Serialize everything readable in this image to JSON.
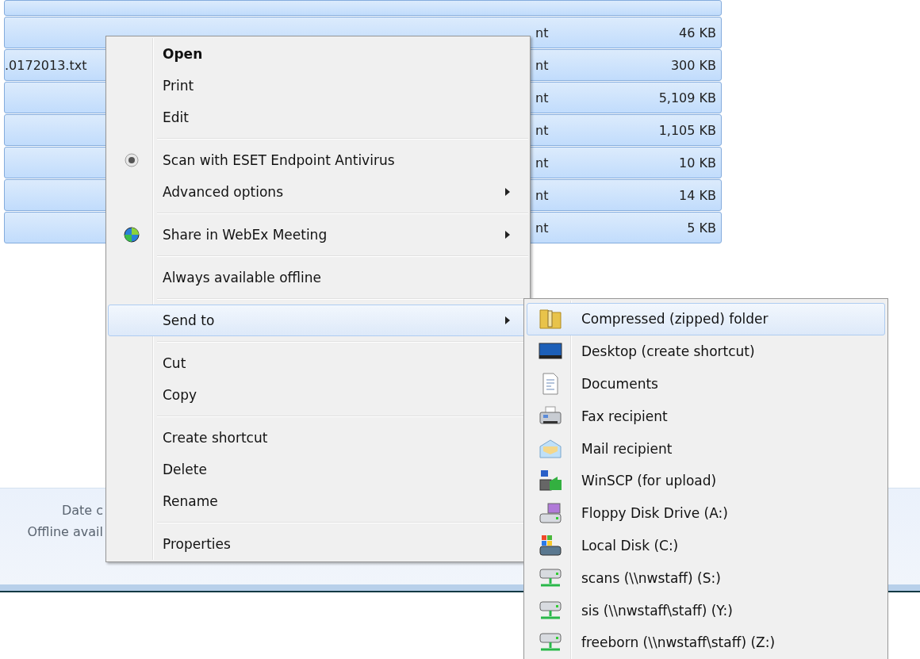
{
  "file_list": {
    "rows": [
      {
        "name": "",
        "type": "",
        "size": "",
        "selected": true
      },
      {
        "name": "",
        "type": "nt",
        "size": "46 KB",
        "selected": true
      },
      {
        "name": ".0172013.txt",
        "type": "nt",
        "size": "300 KB",
        "selected": true
      },
      {
        "name": "",
        "type": "nt",
        "size": "5,109 KB",
        "selected": true
      },
      {
        "name": "",
        "type": "nt",
        "size": "1,105 KB",
        "selected": true
      },
      {
        "name": "",
        "type": "nt",
        "size": "10 KB",
        "selected": true
      },
      {
        "name": "",
        "type": "nt",
        "size": "14 KB",
        "selected": true
      },
      {
        "name": "",
        "type": "nt",
        "size": "5 KB",
        "selected": true
      }
    ]
  },
  "details_pane": {
    "labels": [
      "Date c",
      "Offline avail"
    ]
  },
  "context_menu": {
    "items": [
      {
        "kind": "item",
        "label": "Open",
        "bold": true,
        "submenu": false,
        "selected": false
      },
      {
        "kind": "item",
        "label": "Print",
        "bold": false,
        "submenu": false,
        "selected": false
      },
      {
        "kind": "item",
        "label": "Edit",
        "bold": false,
        "submenu": false,
        "selected": false
      },
      {
        "kind": "separator"
      },
      {
        "kind": "item",
        "label": "Scan with ESET Endpoint Antivirus",
        "bold": false,
        "submenu": false,
        "selected": false
      },
      {
        "kind": "item",
        "label": "Advanced options",
        "bold": false,
        "submenu": true,
        "selected": false
      },
      {
        "kind": "separator"
      },
      {
        "kind": "item",
        "label": "Share in WebEx Meeting",
        "bold": false,
        "submenu": true,
        "selected": false
      },
      {
        "kind": "separator"
      },
      {
        "kind": "item",
        "label": "Always available offline",
        "bold": false,
        "submenu": false,
        "selected": false
      },
      {
        "kind": "separator"
      },
      {
        "kind": "item",
        "label": "Send to",
        "bold": false,
        "submenu": true,
        "selected": true
      },
      {
        "kind": "separator"
      },
      {
        "kind": "item",
        "label": "Cut",
        "bold": false,
        "submenu": false,
        "selected": false
      },
      {
        "kind": "item",
        "label": "Copy",
        "bold": false,
        "submenu": false,
        "selected": false
      },
      {
        "kind": "separator"
      },
      {
        "kind": "item",
        "label": "Create shortcut",
        "bold": false,
        "submenu": false,
        "selected": false
      },
      {
        "kind": "item",
        "label": "Delete",
        "bold": false,
        "submenu": false,
        "selected": false
      },
      {
        "kind": "item",
        "label": "Rename",
        "bold": false,
        "submenu": false,
        "selected": false
      },
      {
        "kind": "separator"
      },
      {
        "kind": "item",
        "label": "Properties",
        "bold": false,
        "submenu": false,
        "selected": false
      }
    ]
  },
  "send_to_menu": {
    "items": [
      {
        "label": "Compressed (zipped) folder",
        "selected": true
      },
      {
        "label": "Desktop (create shortcut)",
        "selected": false
      },
      {
        "label": "Documents",
        "selected": false
      },
      {
        "label": "Fax recipient",
        "selected": false
      },
      {
        "label": "Mail recipient",
        "selected": false
      },
      {
        "label": "WinSCP (for upload)",
        "selected": false
      },
      {
        "label": "Floppy Disk Drive (A:)",
        "selected": false
      },
      {
        "label": "Local Disk (C:)",
        "selected": false
      },
      {
        "label": "scans (\\\\nwstaff) (S:)",
        "selected": false
      },
      {
        "label": "sis (\\\\nwstaff\\staff) (Y:)",
        "selected": false
      },
      {
        "label": "freeborn (\\\\nwstaff\\staff) (Z:)",
        "selected": false
      }
    ]
  }
}
